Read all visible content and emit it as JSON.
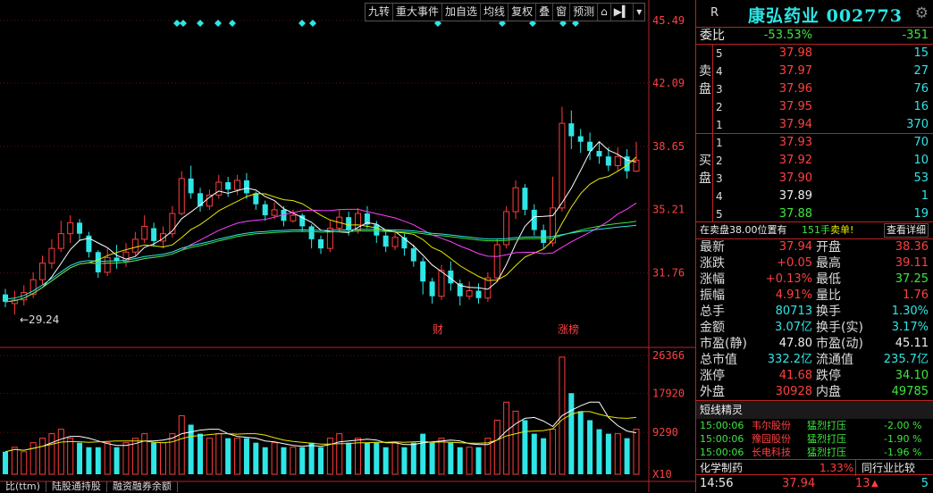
{
  "toolbar": [
    "九转",
    "重大事件",
    "加自选",
    "均线",
    "复权",
    "叠",
    "窗",
    "预测"
  ],
  "toolbar_icons": [
    "lock-icon",
    "play-end-icon",
    "dropdown-icon"
  ],
  "price_axis": [
    "45.49",
    "42.09",
    "38.65",
    "35.21",
    "31.76"
  ],
  "volume_axis": [
    "26366",
    "17920",
    "9290",
    "X10"
  ],
  "low_marker": "←29.24",
  "event_markers": [
    "财",
    "涨榜"
  ],
  "bottom_tabs": [
    "比(ttm)",
    "陆股通持股",
    "融资融券余额"
  ],
  "colors": {
    "up": "#ff3c3c",
    "down": "#2ee6e6",
    "accent": "#b22222"
  },
  "chart_data": {
    "type": "candlestick",
    "price_ylim": [
      28.3,
      45.49
    ],
    "volume_ylim": [
      0,
      26366
    ],
    "candles": [
      [
        30.6,
        30.2,
        30.9,
        29.9
      ],
      [
        30.1,
        30.3,
        30.8,
        29.5
      ],
      [
        30.3,
        30.7,
        31.1,
        30.0
      ],
      [
        30.6,
        31.4,
        31.8,
        30.4
      ],
      [
        31.4,
        32.3,
        32.7,
        31.1
      ],
      [
        32.3,
        33.1,
        33.6,
        32.0
      ],
      [
        33.1,
        33.9,
        34.6,
        32.9
      ],
      [
        33.9,
        34.5,
        34.9,
        33.4
      ],
      [
        34.5,
        33.9,
        34.7,
        33.5
      ],
      [
        33.8,
        32.9,
        34.0,
        32.6
      ],
      [
        32.9,
        31.8,
        33.0,
        31.5
      ],
      [
        31.8,
        32.6,
        33.1,
        31.6
      ],
      [
        32.6,
        32.4,
        33.3,
        32.0
      ],
      [
        32.4,
        32.9,
        33.4,
        32.1
      ],
      [
        32.9,
        33.6,
        34.0,
        32.7
      ],
      [
        33.6,
        34.3,
        34.9,
        33.4
      ],
      [
        34.2,
        33.5,
        34.5,
        33.2
      ],
      [
        33.5,
        33.9,
        34.3,
        33.1
      ],
      [
        33.9,
        35.0,
        35.4,
        33.7
      ],
      [
        35.0,
        36.9,
        37.3,
        34.9
      ],
      [
        36.9,
        36.1,
        37.6,
        35.8
      ],
      [
        36.1,
        35.4,
        36.4,
        35.1
      ],
      [
        35.4,
        36.0,
        36.3,
        35.2
      ],
      [
        36.0,
        36.7,
        37.1,
        35.8
      ],
      [
        36.7,
        36.3,
        37.0,
        35.9
      ],
      [
        36.3,
        36.8,
        37.1,
        36.0
      ],
      [
        36.8,
        36.1,
        37.2,
        35.8
      ],
      [
        36.1,
        35.5,
        36.2,
        35.2
      ],
      [
        35.5,
        34.9,
        35.7,
        34.6
      ],
      [
        34.9,
        35.2,
        35.6,
        34.7
      ],
      [
        35.2,
        34.6,
        35.4,
        34.3
      ],
      [
        34.6,
        34.9,
        35.2,
        34.5
      ],
      [
        34.9,
        34.3,
        35.0,
        34.0
      ],
      [
        34.3,
        33.6,
        34.4,
        33.1
      ],
      [
        33.6,
        33.1,
        33.8,
        32.8
      ],
      [
        33.1,
        34.2,
        34.6,
        32.9
      ],
      [
        34.2,
        34.8,
        35.2,
        34.0
      ],
      [
        34.8,
        34.1,
        35.1,
        33.8
      ],
      [
        34.1,
        35.0,
        35.3,
        33.9
      ],
      [
        35.0,
        34.4,
        35.4,
        34.2
      ],
      [
        34.4,
        33.8,
        34.6,
        33.4
      ],
      [
        33.8,
        33.2,
        34.0,
        32.9
      ],
      [
        33.2,
        33.7,
        34.1,
        33.0
      ],
      [
        33.7,
        33.1,
        33.9,
        32.7
      ],
      [
        33.1,
        32.4,
        33.3,
        32.1
      ],
      [
        32.4,
        31.3,
        32.6,
        30.6
      ],
      [
        31.3,
        30.5,
        31.5,
        30.1
      ],
      [
        30.5,
        31.9,
        32.2,
        30.3
      ],
      [
        31.9,
        31.2,
        32.4,
        30.8
      ],
      [
        31.2,
        30.5,
        31.4,
        30.0
      ],
      [
        30.5,
        30.8,
        31.3,
        30.3
      ],
      [
        30.8,
        30.4,
        31.2,
        30.1
      ],
      [
        30.4,
        31.5,
        31.8,
        30.2
      ],
      [
        31.5,
        33.3,
        33.6,
        31.3
      ],
      [
        33.3,
        35.1,
        35.4,
        33.1
      ],
      [
        35.1,
        36.4,
        36.8,
        34.7
      ],
      [
        36.4,
        35.2,
        36.6,
        34.9
      ],
      [
        35.2,
        34.1,
        35.5,
        33.8
      ],
      [
        34.1,
        33.4,
        34.4,
        33.1
      ],
      [
        33.4,
        35.3,
        37.0,
        33.2
      ],
      [
        35.3,
        39.9,
        40.8,
        35.1
      ],
      [
        39.9,
        39.2,
        40.6,
        38.5
      ],
      [
        39.2,
        38.9,
        39.6,
        38.3
      ],
      [
        38.9,
        38.4,
        39.4,
        37.9
      ],
      [
        38.4,
        38.1,
        38.9,
        37.7
      ],
      [
        38.1,
        37.6,
        38.6,
        37.3
      ],
      [
        37.6,
        38.1,
        38.6,
        37.3
      ],
      [
        38.1,
        37.3,
        38.5,
        36.9
      ],
      [
        37.3,
        37.9,
        38.9,
        37.25
      ]
    ],
    "volumes": [
      5,
      6,
      5,
      7,
      8,
      9,
      10,
      8,
      7,
      6,
      6,
      7,
      6,
      7,
      8,
      9,
      7,
      7,
      9,
      13,
      11,
      9,
      8,
      9,
      8,
      8,
      8,
      7,
      6,
      7,
      6,
      6,
      6,
      7,
      6,
      8,
      9,
      7,
      8,
      7,
      7,
      6,
      7,
      6,
      7,
      9,
      7,
      8,
      7,
      6,
      6,
      6,
      8,
      12,
      16,
      14,
      12,
      9,
      8,
      10,
      26,
      18,
      14,
      12,
      10,
      9,
      9,
      8,
      10
    ]
  },
  "panel": {
    "r_label": "R",
    "stock_name": "康弘药业 002773",
    "gear": "gear-icon",
    "weibi_label": "委比",
    "weibi_pct": "-53.53%",
    "weibi_val": "-351",
    "sell_side": "卖盘",
    "buy_side": "买盘",
    "sell": [
      [
        "5",
        "37.98",
        "15"
      ],
      [
        "4",
        "37.97",
        "27"
      ],
      [
        "3",
        "37.96",
        "76"
      ],
      [
        "2",
        "37.95",
        "16"
      ],
      [
        "1",
        "37.94",
        "370"
      ]
    ],
    "buy": [
      [
        "1",
        "37.93",
        "70"
      ],
      [
        "2",
        "37.92",
        "10"
      ],
      [
        "3",
        "37.90",
        "53"
      ],
      [
        "4",
        "37.89",
        "1"
      ],
      [
        "5",
        "37.88",
        "19"
      ]
    ],
    "sellhint": "在卖盘38.00位置有",
    "sellhint_vol": "151手",
    "sellhint_tag": "卖单!",
    "detail_btn": "查看详细",
    "stats": [
      [
        "最新",
        "37.94",
        "开盘",
        "38.36"
      ],
      [
        "涨跌",
        "+0.05",
        "最高",
        "39.11"
      ],
      [
        "涨幅",
        "+0.13%",
        "最低",
        "37.25"
      ],
      [
        "振幅",
        "4.91%",
        "量比",
        "1.76"
      ],
      [
        "总手",
        "80713",
        "换手",
        "1.30%"
      ],
      [
        "金额",
        "3.07亿",
        "换手(实)",
        "3.17%"
      ],
      [
        "市盈(静)",
        "47.80",
        "市盈(动)",
        "45.11"
      ],
      [
        "总市值",
        "332.2亿",
        "流通值",
        "235.7亿"
      ],
      [
        "涨停",
        "41.68",
        "跌停",
        "34.10"
      ],
      [
        "外盘",
        "30928",
        "内盘",
        "49785"
      ]
    ],
    "news_title": "短线精灵",
    "news": [
      [
        "15:00:06",
        "韦尔股份",
        "猛烈打压",
        "-2.00 %"
      ],
      [
        "15:00:06",
        "豫园股份",
        "猛烈打压",
        "-1.90 %"
      ],
      [
        "15:00:06",
        "长电科技",
        "猛烈打压",
        "-1.96 %"
      ]
    ],
    "sector_name": "化学制药",
    "sector_pct": "1.33%",
    "sector_btn": "同行业比较",
    "last_time": "14:56",
    "last_price": "37.94",
    "last_vol": "13",
    "last_count": "5"
  }
}
